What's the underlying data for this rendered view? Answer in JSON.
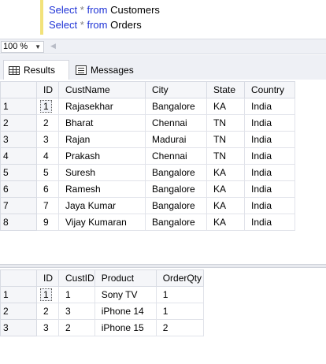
{
  "editor": {
    "line1": {
      "kw1": "Select",
      "star": "*",
      "kw2": "from",
      "table": "Customers"
    },
    "line2": {
      "kw1": "Select",
      "star": "*",
      "kw2": "from",
      "table": "Orders"
    }
  },
  "zoom": {
    "value": "100 %"
  },
  "tabs": {
    "results": {
      "label": "Results",
      "icon": "grid-icon"
    },
    "messages": {
      "label": "Messages",
      "icon": "messages-icon"
    }
  },
  "customers": {
    "columns": [
      "ID",
      "CustName",
      "City",
      "State",
      "Country"
    ],
    "rows": [
      {
        "n": "1",
        "cells": [
          "1",
          "Rajasekhar",
          "Bangalore",
          "KA",
          "India"
        ]
      },
      {
        "n": "2",
        "cells": [
          "2",
          "Bharat",
          "Chennai",
          "TN",
          "India"
        ]
      },
      {
        "n": "3",
        "cells": [
          "3",
          "Rajan",
          "Madurai",
          "TN",
          "India"
        ]
      },
      {
        "n": "4",
        "cells": [
          "4",
          "Prakash",
          "Chennai",
          "TN",
          "India"
        ]
      },
      {
        "n": "5",
        "cells": [
          "5",
          "Suresh",
          "Bangalore",
          "KA",
          "India"
        ]
      },
      {
        "n": "6",
        "cells": [
          "6",
          "Ramesh",
          "Bangalore",
          "KA",
          "India"
        ]
      },
      {
        "n": "7",
        "cells": [
          "7",
          "Jaya Kumar",
          "Bangalore",
          "KA",
          "India"
        ]
      },
      {
        "n": "8",
        "cells": [
          "9",
          "Vijay Kumaran",
          "Bangalore",
          "KA",
          "India"
        ]
      }
    ]
  },
  "orders": {
    "columns": [
      "ID",
      "CustID",
      "Product",
      "OrderQty"
    ],
    "rows": [
      {
        "n": "1",
        "cells": [
          "1",
          "1",
          "Sony TV",
          "1"
        ]
      },
      {
        "n": "2",
        "cells": [
          "2",
          "3",
          "iPhone 14",
          "1"
        ]
      },
      {
        "n": "3",
        "cells": [
          "3",
          "2",
          "iPhone 15",
          "2"
        ]
      }
    ]
  }
}
